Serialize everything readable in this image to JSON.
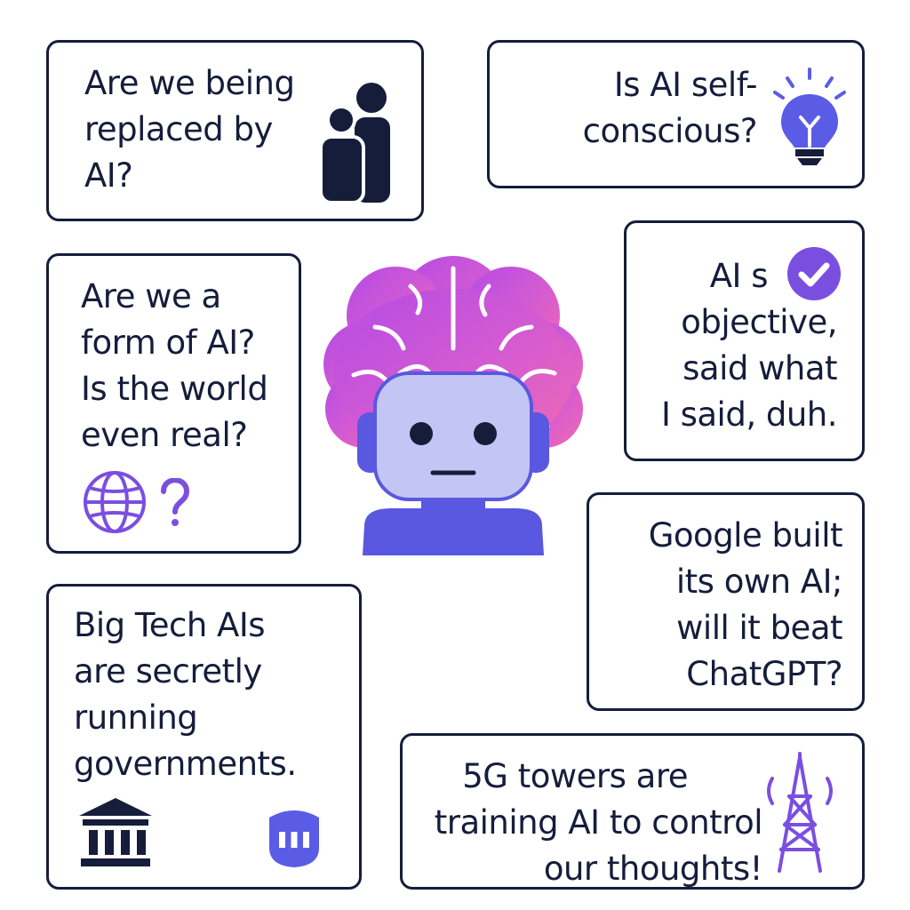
{
  "cards": {
    "replaced": {
      "lines": [
        "Are we being",
        "replaced by",
        "AI?"
      ]
    },
    "self_conscious": {
      "lines": [
        "Is AI self-",
        "conscious?"
      ]
    },
    "form_of_ai": {
      "lines": [
        "Are we a",
        "form of AI?",
        "Is the world",
        "even real?"
      ]
    },
    "objective": {
      "lines": [
        "AI s",
        "objective,",
        "said what",
        "I said, duh."
      ]
    },
    "google": {
      "lines": [
        "Google built",
        "its own AI;",
        "will it beat",
        "ChatGPT?"
      ]
    },
    "big_tech": {
      "lines": [
        "Big Tech AIs",
        "are secretly",
        "running",
        "governments."
      ]
    },
    "towers": {
      "lines": [
        "5G towers are",
        "training AI to control",
        "our thoughts!"
      ]
    }
  },
  "colors": {
    "ink": "#151d3b",
    "accent_purple": "#7a4fe0",
    "accent_blue": "#5b5ce6",
    "brain_pink": "#f06ab3",
    "brain_violet": "#a64ce8",
    "robot_face": "#c3c5f5",
    "robot_body": "#5a57e0"
  },
  "icons": [
    "people-icon",
    "lightbulb-icon",
    "globe-icon",
    "question-mark-icon",
    "checkmark-badge-icon",
    "bank-building-icon",
    "shield-building-icon",
    "cell-tower-icon",
    "brain-robot-illustration"
  ]
}
